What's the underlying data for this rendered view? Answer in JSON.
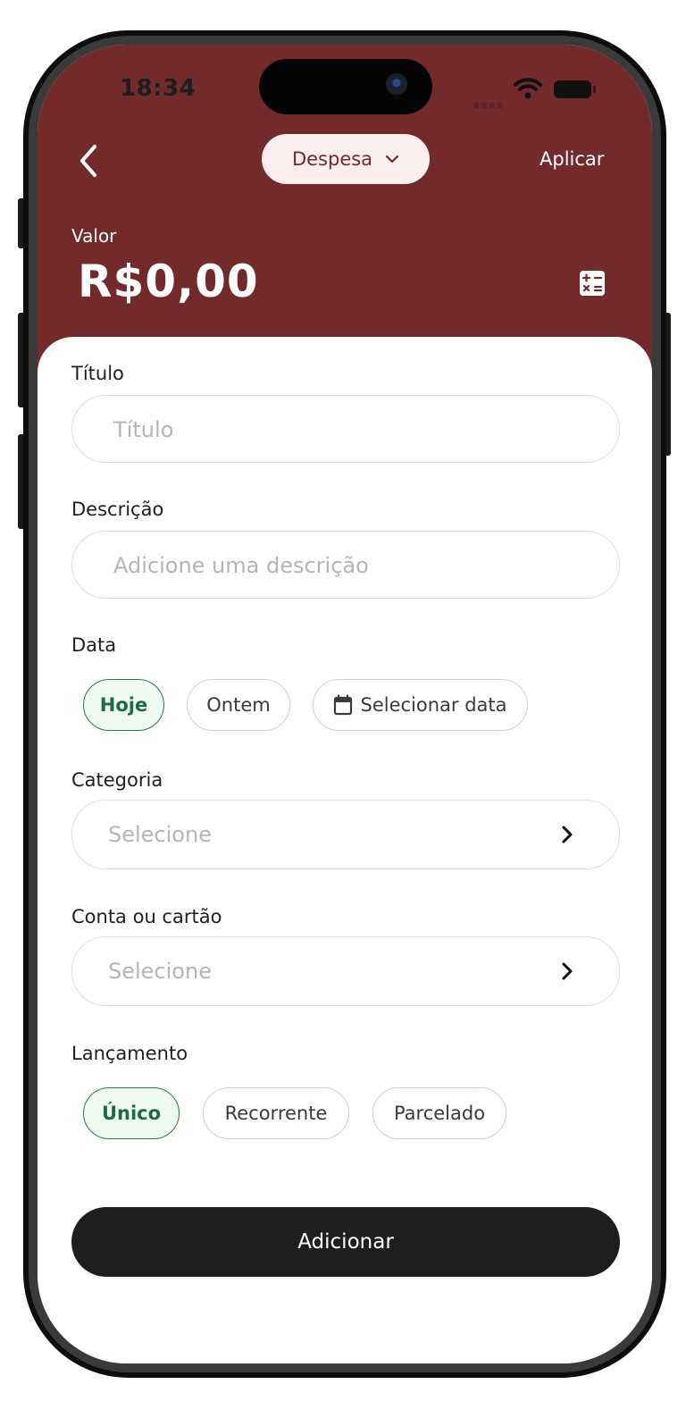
{
  "status_bar": {
    "time": "18:34"
  },
  "header": {
    "back_icon": "chevron-left-icon",
    "type_selector": {
      "label": "Despesa",
      "icon": "chevron-down-icon"
    },
    "apply_label": "Aplicar",
    "value_label": "Valor",
    "value_amount": "R$0,00",
    "calculator_icon": "calculator-icon",
    "background_color": "#722a2b"
  },
  "form": {
    "title": {
      "label": "Título",
      "placeholder": "Título",
      "value": ""
    },
    "description": {
      "label": "Descrição",
      "placeholder": "Adicione uma descrição",
      "value": ""
    },
    "date": {
      "label": "Data",
      "options": [
        "Hoje",
        "Ontem",
        "Selecionar data"
      ],
      "selected": "Hoje",
      "calendar_icon": "calendar-icon"
    },
    "category": {
      "label": "Categoria",
      "placeholder": "Selecione",
      "icon": "chevron-right-icon"
    },
    "account": {
      "label": "Conta ou cartão",
      "placeholder": "Selecione",
      "icon": "chevron-right-icon"
    },
    "entry_type": {
      "label": "Lançamento",
      "options": [
        "Único",
        "Recorrente",
        "Parcelado"
      ],
      "selected": "Único"
    }
  },
  "submit_label": "Adicionar",
  "colors": {
    "accent": "#722a2b",
    "active_chip": "#2a7a4f",
    "button": "#1e1e1e"
  }
}
